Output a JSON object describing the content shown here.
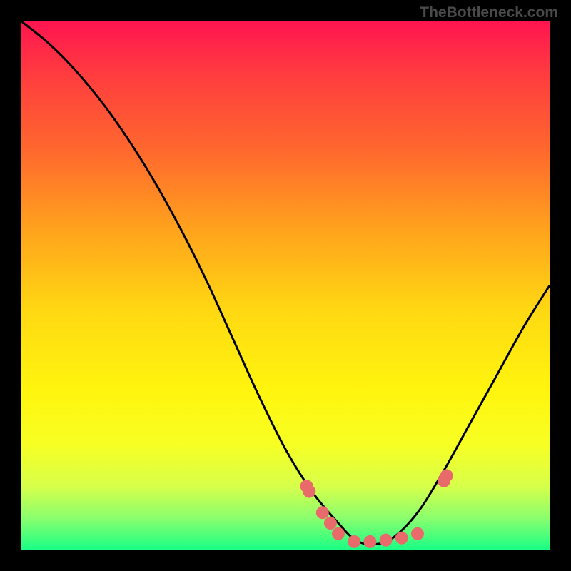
{
  "watermark": "TheBottleneck.com",
  "chart_data": {
    "type": "line",
    "title": "",
    "xlabel": "",
    "ylabel": "",
    "xlim": [
      0,
      100
    ],
    "ylim": [
      0,
      100
    ],
    "background_gradient": {
      "top": "#ff1450",
      "bottom": "#1aff84"
    },
    "series": [
      {
        "name": "bottleneck-curve",
        "color": "#000000",
        "x": [
          0,
          5,
          10,
          15,
          20,
          25,
          30,
          35,
          40,
          45,
          50,
          55,
          60,
          63,
          66,
          70,
          75,
          80,
          85,
          90,
          95,
          100
        ],
        "y": [
          100,
          96,
          91,
          85,
          78,
          70,
          61,
          51,
          40,
          29,
          19,
          11,
          5,
          2,
          1,
          2,
          7,
          15,
          24,
          33,
          42,
          50
        ]
      }
    ],
    "markers": {
      "name": "highlight-points",
      "color": "#e96a6a",
      "radius": 9,
      "x": [
        54,
        54.5,
        57,
        58.5,
        60,
        63,
        66,
        69,
        72,
        75,
        80,
        80.5
      ],
      "y": [
        12,
        11,
        7,
        5,
        3,
        1.5,
        1.5,
        1.8,
        2.2,
        3,
        13,
        14
      ]
    }
  }
}
